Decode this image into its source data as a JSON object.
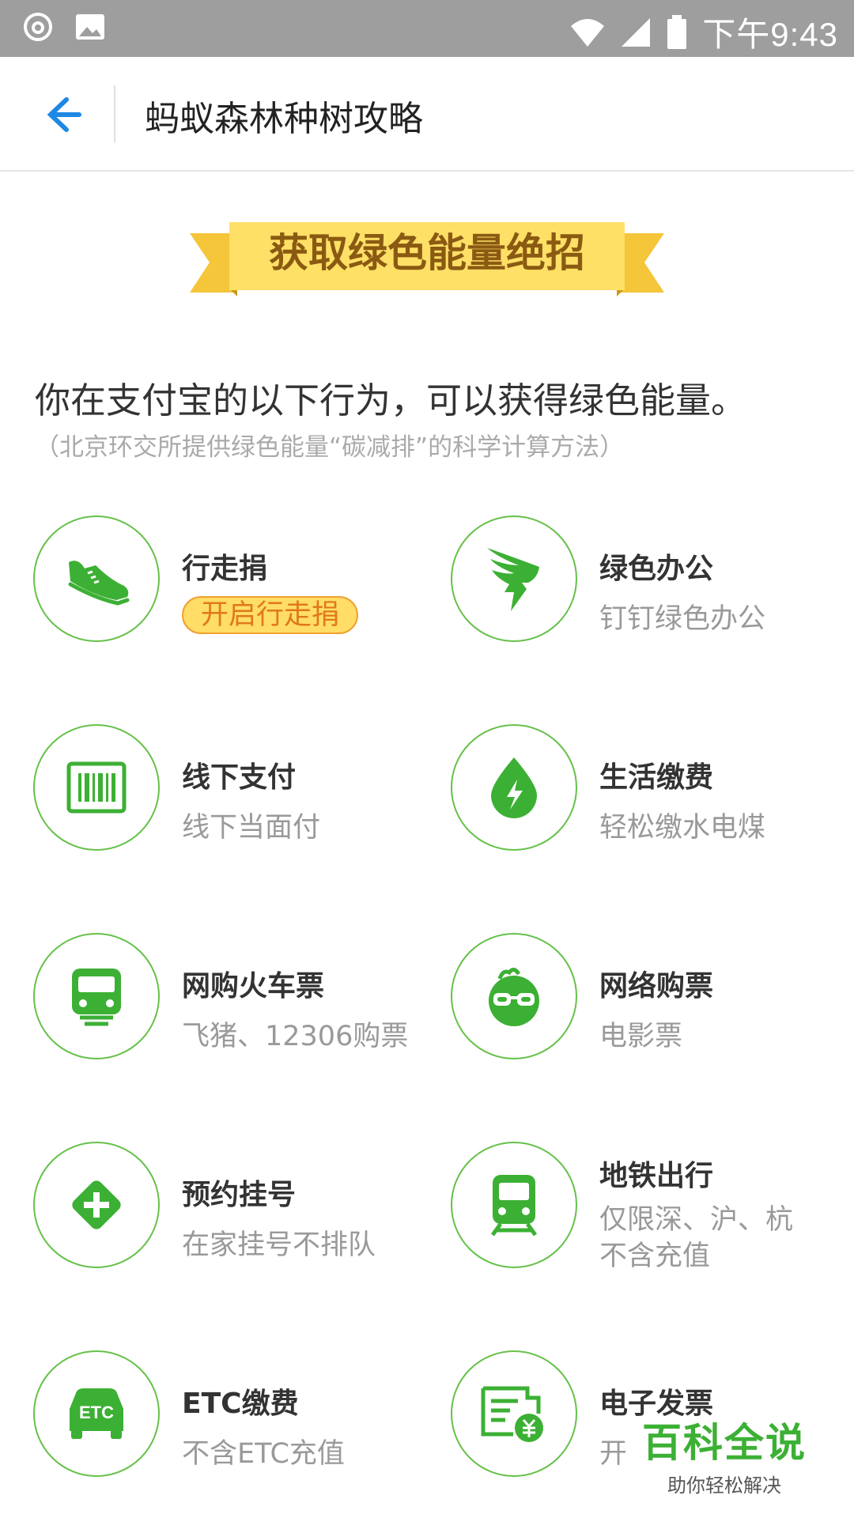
{
  "status_bar": {
    "time": "下午9:43"
  },
  "nav": {
    "title": "蚂蚁森林种树攻略"
  },
  "banner": {
    "title": "获取绿色能量绝招"
  },
  "intro": {
    "heading": "你在支付宝的以下行为，可以获得绿色能量。",
    "subheading": "（北京环交所提供绿色能量“碳减排”的科学计算方法）"
  },
  "items": [
    {
      "title": "行走捐",
      "badge": "开启行走捐",
      "icon": "shoe-icon"
    },
    {
      "title": "绿色办公",
      "desc": "钉钉绿色办公",
      "icon": "dingtalk-icon"
    },
    {
      "title": "线下支付",
      "desc": "线下当面付",
      "icon": "barcode-icon"
    },
    {
      "title": "生活缴费",
      "desc": "轻松缴水电煤",
      "icon": "energy-drop-icon"
    },
    {
      "title": "网购火车票",
      "desc": "飞猪、12306购票",
      "icon": "train-icon"
    },
    {
      "title": "网络购票",
      "desc": "电影票",
      "icon": "glasses-face-icon"
    },
    {
      "title": "预约挂号",
      "desc": "在家挂号不排队",
      "icon": "medical-cross-icon"
    },
    {
      "title": "地铁出行",
      "desc": "仅限深、沪、杭",
      "desc2": "不含充值",
      "icon": "metro-icon"
    },
    {
      "title": "ETC缴费",
      "desc": "不含ETC充值",
      "icon": "etc-car-icon",
      "icon_text": "ETC"
    },
    {
      "title": "电子发票",
      "desc": "开",
      "icon": "invoice-icon"
    }
  ],
  "watermark": {
    "title": "百科全说",
    "subtitle": "助你轻松解决"
  },
  "colors": {
    "green": "#3cb034",
    "circle_border": "#66c14a",
    "banner_yellow": "#ffe066",
    "status_bar": "#9e9e9e",
    "back_arrow": "#1e88e5"
  }
}
